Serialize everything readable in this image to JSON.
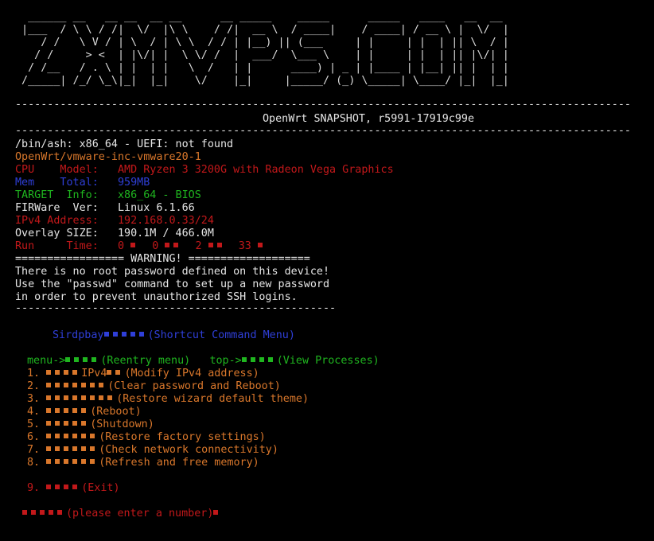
{
  "colors": {
    "background": "#000000",
    "text": "#e6e6e6",
    "orange": "#d9772b",
    "red": "#c2181a",
    "blue": "#2f3fd8",
    "green": "#1fb51f"
  },
  "banner": {
    "text": "  ______ __   __ __  __ __      __ _____    _____      _____   ____   __  __ \n |___  / \\ \\ / /|  \\/  |\\ \\    / /|  __ \\  / ____|    / ____| / __ \\ |  \\/  |\n    / /   \\ V / | \\  / | \\ \\  / / | |__) || (___     | |     | |  | || \\  / |\n   / /     > <  | |\\/| |  \\ \\/ /  |  ___/  \\___ \\    | |     | |  | || |\\/| |\n  / /__   / . \\ | |  | |   \\  /   | |      ____) | _ | |____ | |__| || |  | |\n /_____| /_/ \\_\\|_|  |_|    \\/    |_|     |_____/ (_) \\_____| \\____/ |_|  |_|"
  },
  "separator": "------------------------------------------------------------------------------------------------",
  "release": "OpenWrt SNAPSHOT, r5991-17919c99e",
  "shell_line": "/bin/ash: x86_64 - UEFI: not found",
  "device": "OpenWrt/vmware-inc-vmware20-1",
  "info": {
    "cpu_label": "CPU    Model:",
    "cpu_value": "AMD Ryzen 3 3200G with Radeon Vega Graphics",
    "mem_label": "Mem    Total:",
    "mem_value": "959MB",
    "target_label": "TARGET  Info:",
    "target_value": "x86_64 - BIOS",
    "firmware_label": "FIRWare  Ver:",
    "firmware_value": "Linux 6.1.66",
    "ipv4_label": "IPv4 Address:",
    "ipv4_value": "192.168.0.33/24",
    "overlay_label": "Overlay SIZE:",
    "overlay_value": "190.1M / 466.0M",
    "run_label": "Run     Time:",
    "run_d": "0",
    "run_h": "0",
    "run_m": "2",
    "run_s": "33"
  },
  "warning_header": "================= WARNING! ===================",
  "warning_lines": [
    "There is no root password defined on this device!",
    "Use the \"passwd\" command to set up a new password",
    "in order to prevent unauthorized SSH logins."
  ],
  "warning_footer": "--------------------------------------------------",
  "menu": {
    "title_prefix": "Sirdpbay",
    "title_suffix": "(Shortcut Command Menu)",
    "menu_cmd": "menu->",
    "menu_desc": "(Reentry menu)",
    "top_cmd": "top->",
    "top_desc": "(View Processes)",
    "items": [
      {
        "num": "1.",
        "text": "IPv4",
        "desc": "(Modify IPv4 address)"
      },
      {
        "num": "2.",
        "text": "",
        "desc": "(Clear password and Reboot)"
      },
      {
        "num": "3.",
        "text": "",
        "desc": "(Restore wizard default theme)"
      },
      {
        "num": "4.",
        "text": "",
        "desc": "(Reboot)"
      },
      {
        "num": "5.",
        "text": "",
        "desc": "(Shutdown)"
      },
      {
        "num": "6.",
        "text": "",
        "desc": "(Restore factory settings)"
      },
      {
        "num": "7.",
        "text": "",
        "desc": "(Check network connectivity)"
      },
      {
        "num": "8.",
        "text": "",
        "desc": "(Refresh and free memory)"
      }
    ],
    "exit": {
      "num": "9.",
      "desc": "(Exit)"
    },
    "prompt": "(please enter a number)"
  }
}
